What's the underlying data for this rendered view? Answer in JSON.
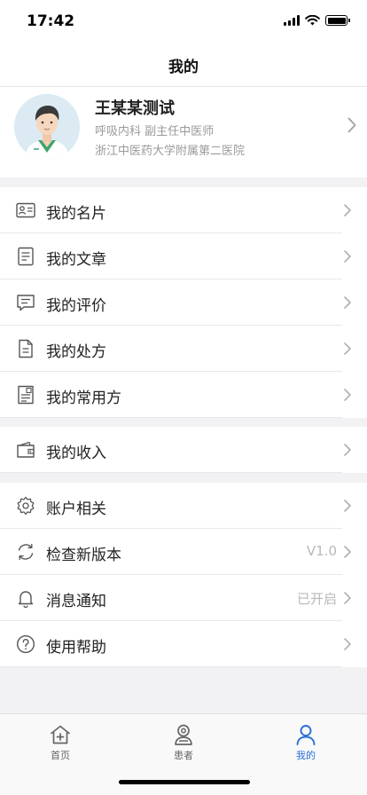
{
  "status_bar": {
    "time": "17:42"
  },
  "header": {
    "title": "我的"
  },
  "profile": {
    "name": "王某某测试",
    "department_title": "呼吸内科  副主任中医师",
    "hospital": "浙江中医药大学附属第二医院"
  },
  "menu_group_1": [
    {
      "label": "我的名片",
      "icon": "id-card-icon"
    },
    {
      "label": "我的文章",
      "icon": "document-icon"
    },
    {
      "label": "我的评价",
      "icon": "comment-icon"
    },
    {
      "label": "我的处方",
      "icon": "prescription-icon"
    },
    {
      "label": "我的常用方",
      "icon": "common-prescription-icon"
    }
  ],
  "menu_group_2": [
    {
      "label": "我的收入",
      "icon": "wallet-icon"
    }
  ],
  "menu_group_3": [
    {
      "label": "账户相关",
      "icon": "gear-icon",
      "value": ""
    },
    {
      "label": "检查新版本",
      "icon": "refresh-icon",
      "value": "V1.0"
    },
    {
      "label": "消息通知",
      "icon": "bell-icon",
      "value": "已开启"
    },
    {
      "label": "使用帮助",
      "icon": "help-icon",
      "value": ""
    }
  ],
  "tab_bar": {
    "tabs": [
      {
        "label": "首页",
        "icon": "home-icon"
      },
      {
        "label": "患者",
        "icon": "patient-icon"
      },
      {
        "label": "我的",
        "icon": "user-icon",
        "active": true
      }
    ],
    "active_color": "#2b6fd6"
  }
}
